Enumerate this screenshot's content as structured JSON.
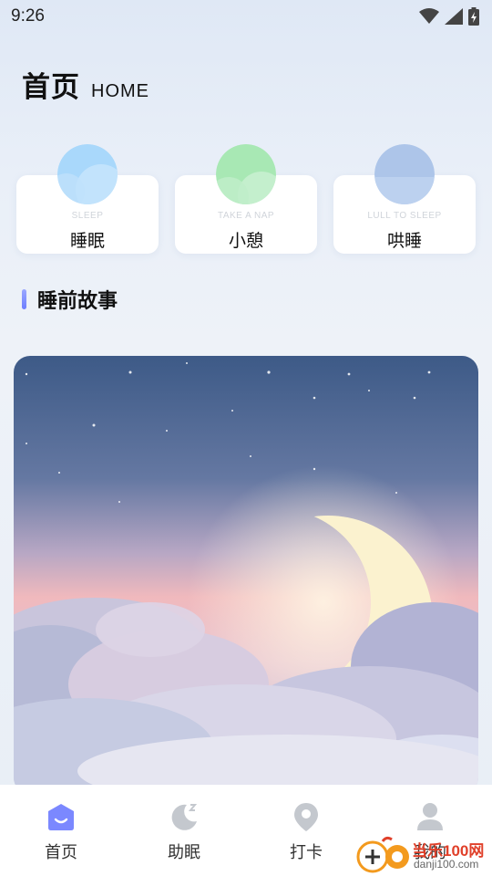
{
  "status_bar": {
    "time": "9:26"
  },
  "header": {
    "title": "首页",
    "subtitle": "HOME"
  },
  "modes": [
    {
      "en": "SLEEP",
      "cn": "睡眠",
      "color": "#a9d8fb"
    },
    {
      "en": "TAKE A NAP",
      "cn": "小憩",
      "color": "#a8e8b4"
    },
    {
      "en": "LULL TO SLEEP",
      "cn": "哄睡",
      "color": "#adc5e9"
    }
  ],
  "section": {
    "title": "睡前故事"
  },
  "tabs": [
    {
      "label": "首页",
      "icon": "home-face-icon",
      "active": true
    },
    {
      "label": "助眠",
      "icon": "moon-sleep-icon",
      "active": false
    },
    {
      "label": "打卡",
      "icon": "location-pin-icon",
      "active": false
    },
    {
      "label": "我的",
      "icon": "person-icon",
      "active": false
    }
  ],
  "watermark": {
    "brand": "当乐100网",
    "domain": "danji100.com"
  },
  "colors": {
    "accent": "#7b88ff",
    "tab_active": "#7b88ff",
    "tab_inactive": "#c4c8ce"
  }
}
